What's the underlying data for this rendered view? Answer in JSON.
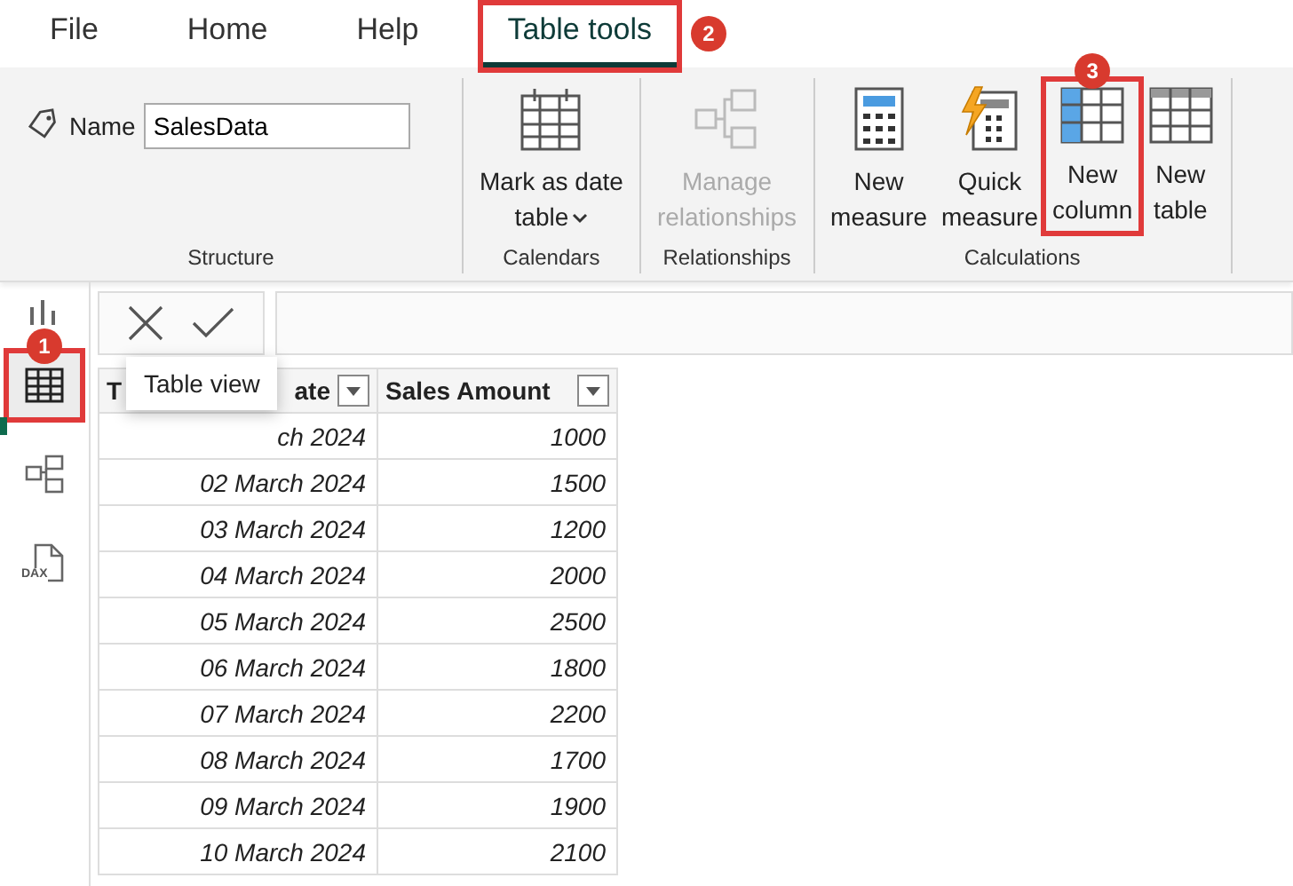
{
  "tabs": [
    {
      "label": "File",
      "selected": false,
      "highlighted": false
    },
    {
      "label": "Home",
      "selected": false,
      "highlighted": false
    },
    {
      "label": "Help",
      "selected": false,
      "highlighted": false
    },
    {
      "label": "Table tools",
      "selected": true,
      "highlighted": true,
      "badge": "2"
    }
  ],
  "ribbon": {
    "groups": [
      {
        "kind": "structure",
        "label": "Structure",
        "field": {
          "label": "Name",
          "value": "SalesData"
        }
      },
      {
        "kind": "buttons",
        "label": "Calendars",
        "buttons": [
          {
            "kind": "calendar",
            "label": "Mark as date\ntable",
            "caret": true,
            "disabled": false,
            "highlighted": false
          }
        ]
      },
      {
        "kind": "buttons",
        "label": "Relationships",
        "buttons": [
          {
            "kind": "manage",
            "label": "Manage\nrelationships",
            "disabled": true,
            "highlighted": false
          }
        ]
      },
      {
        "kind": "buttons",
        "label": "Calculations",
        "buttons": [
          {
            "kind": "measure",
            "label": "New\nmeasure",
            "disabled": false,
            "highlighted": false
          },
          {
            "kind": "quick",
            "label": "Quick\nmeasure",
            "disabled": false,
            "highlighted": false
          },
          {
            "kind": "column",
            "label": "New\ncolumn",
            "disabled": false,
            "highlighted": true,
            "badge": "3"
          },
          {
            "kind": "table",
            "label": "New\ntable",
            "disabled": false,
            "highlighted": false
          }
        ]
      }
    ]
  },
  "sidebar": {
    "items": [
      {
        "kind": "report",
        "selected": false,
        "highlighted": false
      },
      {
        "kind": "table",
        "selected": true,
        "highlighted": true,
        "badge": "1",
        "tooltip": "Table view"
      },
      {
        "kind": "model",
        "selected": false,
        "highlighted": false
      },
      {
        "kind": "dax",
        "selected": false,
        "highlighted": false,
        "icon_text": "DAX"
      }
    ]
  },
  "table": {
    "columns": [
      {
        "label_start": "T",
        "label_end": "ate"
      },
      {
        "label_start": "Sales Amount"
      }
    ],
    "rows": [
      [
        "ch 2024",
        "1000"
      ],
      [
        "02 March 2024",
        "1500"
      ],
      [
        "03 March 2024",
        "1200"
      ],
      [
        "04 March 2024",
        "2000"
      ],
      [
        "05 March 2024",
        "2500"
      ],
      [
        "06 March 2024",
        "1800"
      ],
      [
        "07 March 2024",
        "2200"
      ],
      [
        "08 March 2024",
        "1700"
      ],
      [
        "09 March 2024",
        "1900"
      ],
      [
        "10 March 2024",
        "2100"
      ]
    ]
  }
}
